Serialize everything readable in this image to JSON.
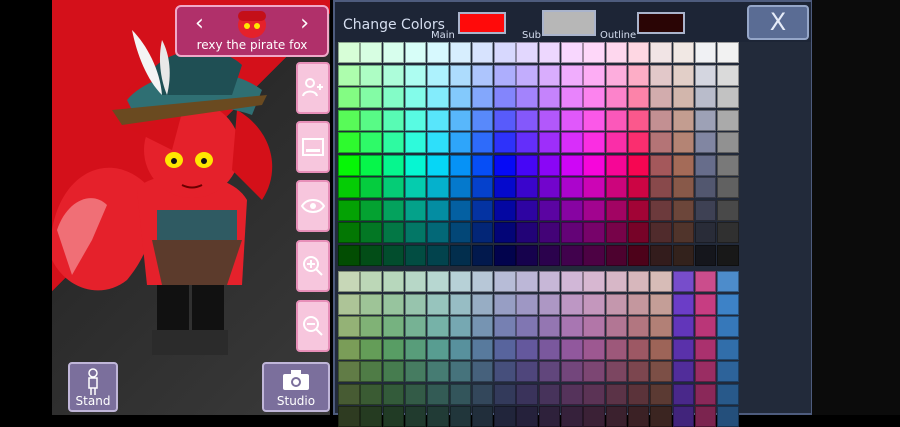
{
  "character": {
    "name": "rexy the pirate fox",
    "prev_glyph": "‹",
    "next_glyph": "›"
  },
  "tools": {
    "icons": [
      "add-person-icon",
      "image-icon",
      "eye-icon",
      "zoom-in-icon",
      "zoom-out-icon"
    ]
  },
  "bottom": {
    "stand_label": "Stand",
    "studio_label": "Studio"
  },
  "panel": {
    "title": "Change Colors",
    "main_label": "Main",
    "sub_label": "Sub",
    "outline_label": "Outline",
    "main_color": "#ff0a0a",
    "sub_color": "#b7b7b7",
    "outline_color": "#2a0505",
    "close_label": "X"
  },
  "colors": {
    "stage_red": "#d4101a",
    "panel_bg": "#222a3a",
    "pink_button": "#f7c6dd",
    "selector_bg": "#b0306a"
  }
}
